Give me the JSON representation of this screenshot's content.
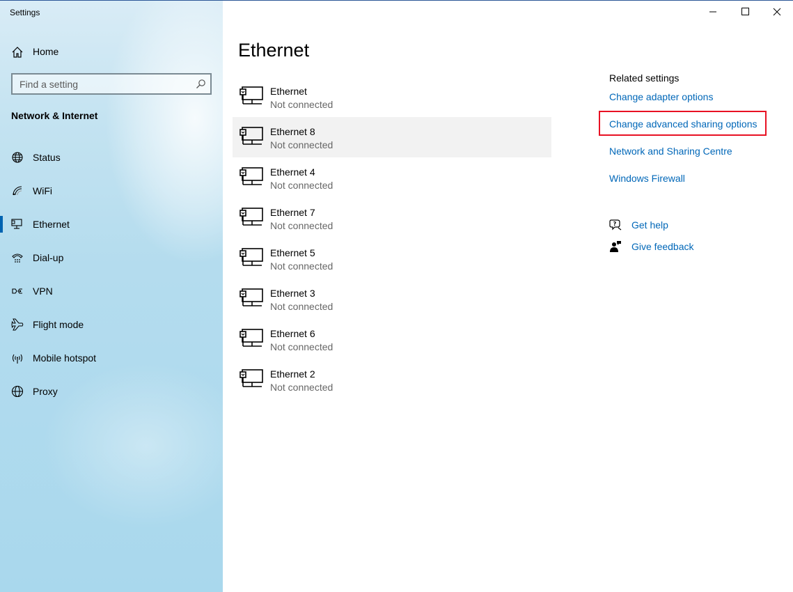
{
  "window": {
    "title": "Settings"
  },
  "sidebar": {
    "home_label": "Home",
    "search_placeholder": "Find a setting",
    "section_title": "Network & Internet",
    "items": [
      {
        "label": "Status",
        "icon": "globe-status-icon"
      },
      {
        "label": "WiFi",
        "icon": "wifi-icon"
      },
      {
        "label": "Ethernet",
        "icon": "ethernet-icon",
        "selected": true
      },
      {
        "label": "Dial-up",
        "icon": "dialup-icon"
      },
      {
        "label": "VPN",
        "icon": "vpn-icon"
      },
      {
        "label": "Flight mode",
        "icon": "airplane-icon"
      },
      {
        "label": "Mobile hotspot",
        "icon": "hotspot-icon"
      },
      {
        "label": "Proxy",
        "icon": "globe-icon"
      }
    ]
  },
  "main": {
    "title": "Ethernet",
    "adapters": [
      {
        "name": "Ethernet",
        "status": "Not connected"
      },
      {
        "name": "Ethernet 8",
        "status": "Not connected",
        "highlighted": true
      },
      {
        "name": "Ethernet 4",
        "status": "Not connected"
      },
      {
        "name": "Ethernet 7",
        "status": "Not connected"
      },
      {
        "name": "Ethernet 5",
        "status": "Not connected"
      },
      {
        "name": "Ethernet 3",
        "status": "Not connected"
      },
      {
        "name": "Ethernet 6",
        "status": "Not connected"
      },
      {
        "name": "Ethernet 2",
        "status": "Not connected"
      }
    ]
  },
  "related": {
    "title": "Related settings",
    "links": [
      "Change adapter options",
      "Change advanced sharing options",
      "Network and Sharing Centre",
      "Windows Firewall"
    ],
    "get_help": "Get help",
    "give_feedback": "Give feedback"
  },
  "colors": {
    "accent": "#0063b1",
    "link": "#0067b8",
    "highlight_border": "#e81123",
    "selected_row": "#f2f2f2"
  }
}
